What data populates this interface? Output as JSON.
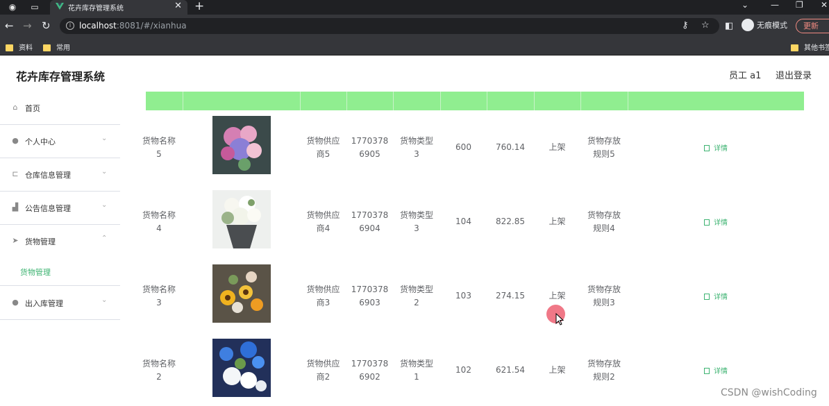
{
  "browser": {
    "tab_title": "花卉库存管理系统",
    "url_host": "localhost",
    "url_rest": ":8081/#/xianhua",
    "incognito_label": "无痕模式",
    "update_label": "更新",
    "bookmarks": [
      "资料",
      "常用"
    ],
    "bookmarks_right": "其他书签"
  },
  "app": {
    "title": "花卉库存管理系统",
    "user": "员工 a1",
    "logout": "退出登录"
  },
  "sidebar": {
    "items": [
      {
        "label": "首页",
        "icon": "home-icon"
      },
      {
        "label": "个人中心",
        "icon": "user-icon"
      },
      {
        "label": "仓库信息管理",
        "icon": "crop-icon"
      },
      {
        "label": "公告信息管理",
        "icon": "chart-icon"
      },
      {
        "label": "货物管理",
        "icon": "send-icon"
      },
      {
        "label": "出入库管理",
        "icon": "user-icon"
      }
    ],
    "sub_item": "货物管理"
  },
  "table": {
    "detail_label": "详情",
    "rows": [
      {
        "name": [
          "货物名称",
          "5"
        ],
        "supplier": [
          "货物供应",
          "商5"
        ],
        "phone": [
          "1770378",
          "6905"
        ],
        "type": [
          "货物类型",
          "3"
        ],
        "qty": "600",
        "price": "760.14",
        "status": "上架",
        "rule": [
          "货物存放",
          "规则5"
        ],
        "image": "bouquet-pink-purple"
      },
      {
        "name": [
          "货物名称",
          "4"
        ],
        "supplier": [
          "货物供应",
          "商4"
        ],
        "phone": [
          "1770378",
          "6904"
        ],
        "type": [
          "货物类型",
          "3"
        ],
        "qty": "104",
        "price": "822.85",
        "status": "上架",
        "rule": [
          "货物存放",
          "规则4"
        ],
        "image": "bouquet-white"
      },
      {
        "name": [
          "货物名称",
          "3"
        ],
        "supplier": [
          "货物供应",
          "商3"
        ],
        "phone": [
          "1770378",
          "6903"
        ],
        "type": [
          "货物类型",
          "2"
        ],
        "qty": "103",
        "price": "274.15",
        "status": "上架",
        "rule": [
          "货物存放",
          "规则3"
        ],
        "image": "bouquet-sunflower"
      },
      {
        "name": [
          "货物名称",
          "2"
        ],
        "supplier": [
          "货物供应",
          "商2"
        ],
        "phone": [
          "1770378",
          "6902"
        ],
        "type": [
          "货物类型",
          "1"
        ],
        "qty": "102",
        "price": "621.54",
        "status": "上架",
        "rule": [
          "货物存放",
          "规则2"
        ],
        "image": "bouquet-blue-white"
      }
    ]
  },
  "watermark": "CSDN @wishCoding",
  "colors": {
    "header_green": "#90ee90",
    "accent_green": "#3cb371"
  }
}
